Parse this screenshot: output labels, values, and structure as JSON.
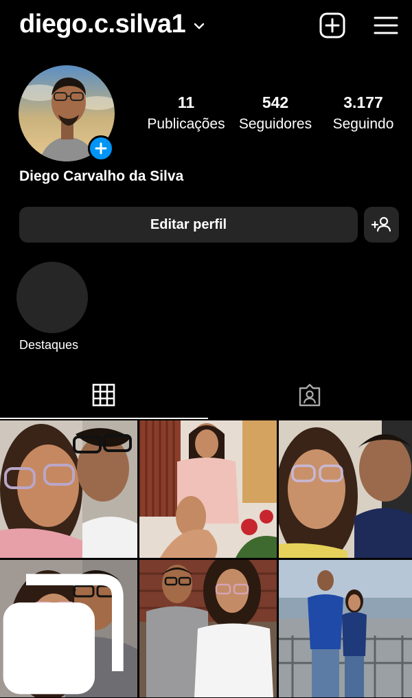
{
  "header": {
    "username": "diego.c.silva1",
    "icons": [
      "chevron-down-icon",
      "new-post-icon",
      "menu-icon"
    ]
  },
  "profile": {
    "full_name": "Diego Carvalho da Silva",
    "stats": [
      {
        "value": "11",
        "label": "Publicações"
      },
      {
        "value": "542",
        "label": "Seguidores"
      },
      {
        "value": "3.177",
        "label": "Seguindo"
      }
    ]
  },
  "actions": {
    "edit_profile": "Editar perfil"
  },
  "highlights": [
    {
      "label": "Destaques"
    }
  ],
  "tabs": [
    {
      "name": "posts-grid",
      "icon": "grid-icon",
      "active": true
    },
    {
      "name": "tagged",
      "icon": "tagged-person-icon",
      "active": false
    }
  ],
  "colors": {
    "background": "#000000",
    "button": "#262626",
    "accent": "#0095f6",
    "text": "#ffffff"
  }
}
